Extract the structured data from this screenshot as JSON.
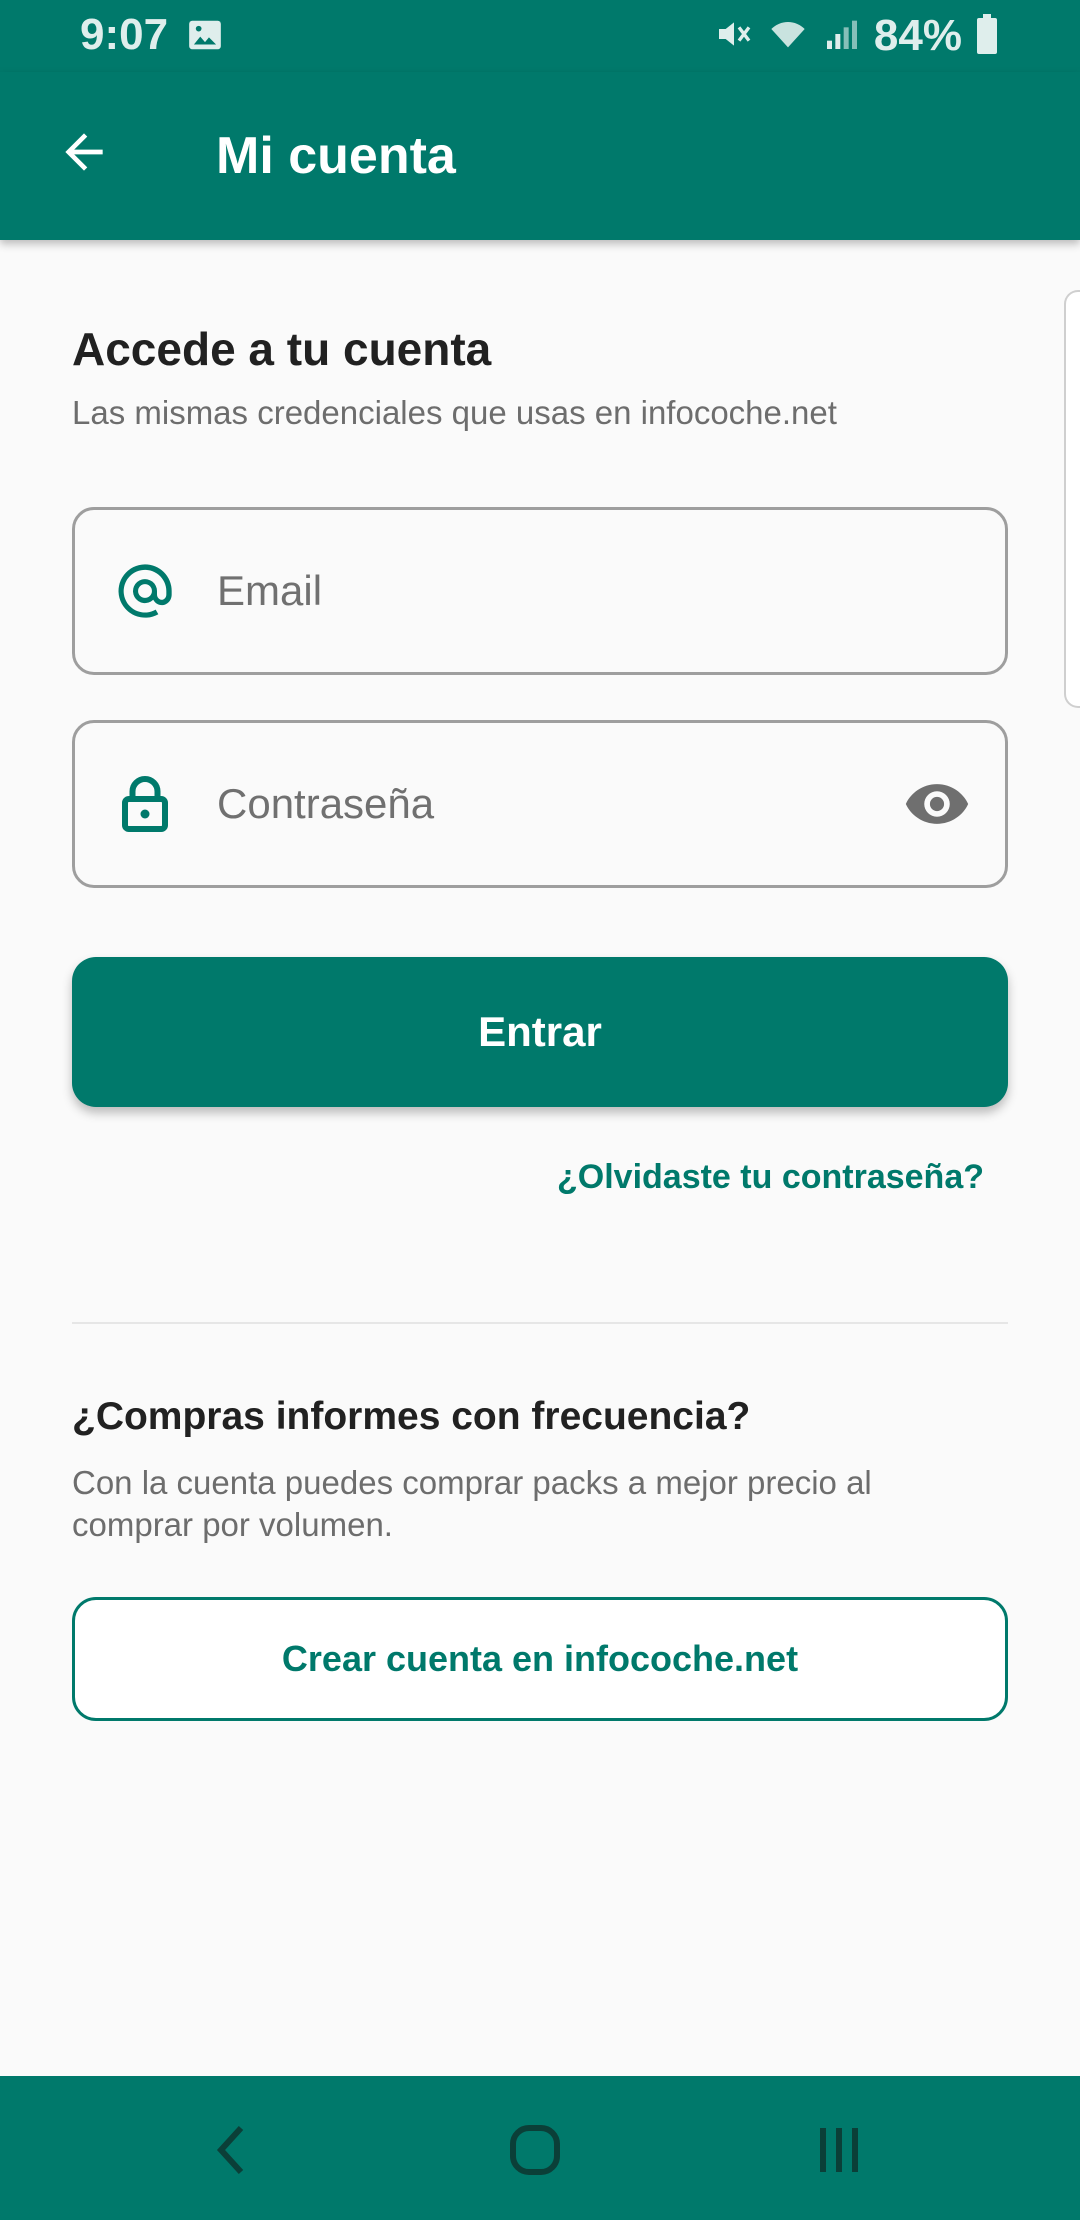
{
  "status_bar": {
    "time": "9:07",
    "battery": "84%",
    "icons": [
      "gallery-icon",
      "mute-icon",
      "wifi-icon",
      "signal-icon",
      "battery-icon"
    ]
  },
  "app_bar": {
    "title": "Mi cuenta",
    "back_icon": "arrow-left-icon"
  },
  "login": {
    "heading": "Accede a tu cuenta",
    "subheading": "Las mismas credenciales que usas en infocoche.net",
    "email": {
      "placeholder": "Email",
      "value": "",
      "icon": "at-sign-icon"
    },
    "password": {
      "placeholder": "Contraseña",
      "value": "",
      "icon": "lock-icon",
      "toggle_icon": "eye-icon"
    },
    "submit_label": "Entrar",
    "forgot_label": "¿Olvidaste tu contraseña?"
  },
  "signup": {
    "heading": "¿Compras informes con frecuencia?",
    "description": "Con la cuenta puedes comprar packs a mejor precio al comprar por volumen.",
    "button_label": "Crear cuenta en infocoche.net"
  },
  "nav_bar": {
    "icons": [
      "nav-back-icon",
      "nav-home-icon",
      "nav-recents-icon"
    ]
  },
  "colors": {
    "primary": "#00796b",
    "background": "#fafafa",
    "text_primary": "#212121",
    "text_secondary": "#6d6d6d"
  }
}
